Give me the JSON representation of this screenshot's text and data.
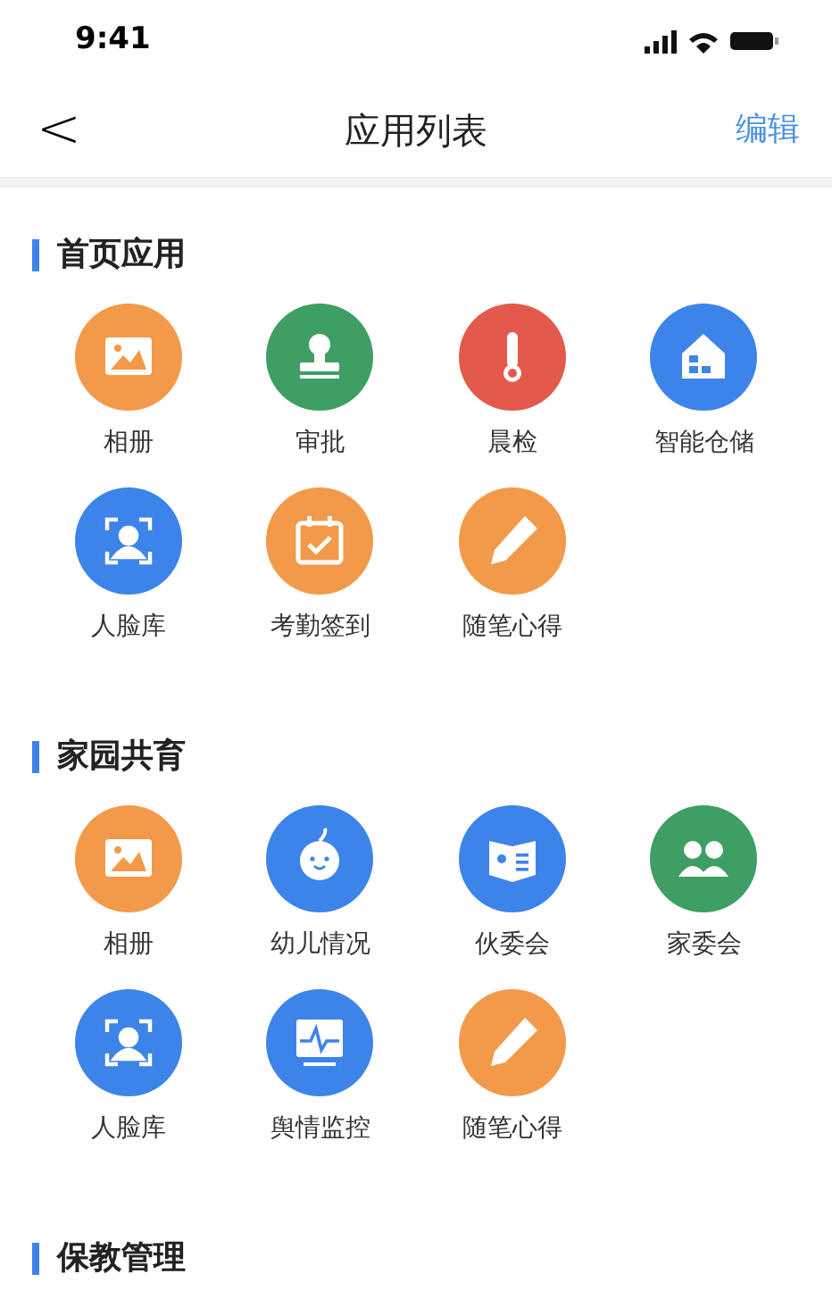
{
  "status_bar": {
    "time": "9:41"
  },
  "nav": {
    "back": "<",
    "title": "应用列表",
    "action": "编辑"
  },
  "sections": [
    {
      "title": "首页应用",
      "apps": [
        {
          "label": "相册",
          "kind": "photo",
          "color": "#f29a4a"
        },
        {
          "label": "审批",
          "kind": "stamp",
          "color": "#3e9e64"
        },
        {
          "label": "晨检",
          "kind": "thermometer",
          "color": "#e35a4c"
        },
        {
          "label": "智能仓储",
          "kind": "warehouse",
          "color": "#3d84ea"
        },
        {
          "label": "人脸库",
          "kind": "face",
          "color": "#3d84ea"
        },
        {
          "label": "考勤签到",
          "kind": "calendar",
          "color": "#f29a4a"
        },
        {
          "label": "随笔心得",
          "kind": "pencil",
          "color": "#f29a4a"
        }
      ]
    },
    {
      "title": "家园共育",
      "apps": [
        {
          "label": "相册",
          "kind": "photo",
          "color": "#f29a4a"
        },
        {
          "label": "幼儿情况",
          "kind": "baby",
          "color": "#3d84ea"
        },
        {
          "label": "伙委会",
          "kind": "book",
          "color": "#3d84ea"
        },
        {
          "label": "家委会",
          "kind": "people",
          "color": "#3e9e64"
        },
        {
          "label": "人脸库",
          "kind": "face",
          "color": "#3d84ea"
        },
        {
          "label": "舆情监控",
          "kind": "monitor",
          "color": "#3d84ea"
        },
        {
          "label": "随笔心得",
          "kind": "pencil",
          "color": "#f29a4a"
        }
      ]
    },
    {
      "title": "保教管理"
    }
  ]
}
